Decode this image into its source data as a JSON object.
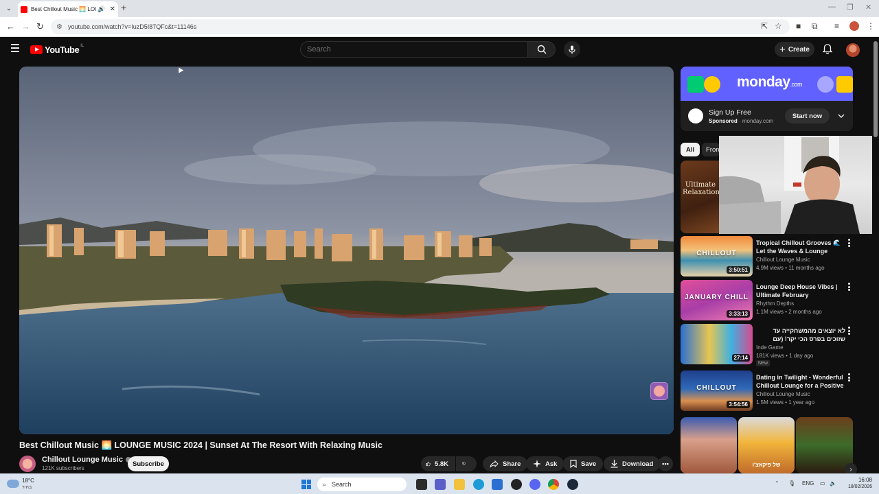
{
  "browser": {
    "tab_title": "Best Chillout Music 🌅 LOUNGE",
    "url": "youtube.com/watch?v=IuzD5I87QFc&t=11146s"
  },
  "header": {
    "logo_text": "YouTube",
    "logo_country": "IL",
    "search_placeholder": "Search",
    "create_label": "Create"
  },
  "video": {
    "title": "Best Chillout Music 🌅 LOUNGE MUSIC 2024 | Sunset At The Resort With Relaxing Music",
    "channel_name": "Chillout Lounge Music",
    "subscribers": "121K subscribers",
    "subscribe_label": "Subscribe",
    "likes": "5.8K",
    "share_label": "Share",
    "ask_label": "Ask",
    "save_label": "Save",
    "download_label": "Download"
  },
  "ad": {
    "brand": "monday",
    "brand_suffix": ".com",
    "title": "Sign Up Free",
    "sponsored": "Sponsored",
    "domain": "monday.com",
    "cta": "Start now"
  },
  "chips": [
    "All",
    "From"
  ],
  "first_thumb_text": "Ultimate Relaxation",
  "recommendations": [
    {
      "title": "Tropical Chillout Grooves 🌊 Let the Waves & Lounge Music...",
      "channel": "Chillout Lounge Music",
      "meta": "4.9M views • 11 months ago",
      "duration": "3:50:51",
      "thumb_label": "CHILLOUT",
      "badge": "",
      "rtl": false
    },
    {
      "title": "Lounge Deep House Vibes | Ultimate February Background...",
      "channel": "Rhythm Depths",
      "meta": "1.1M views • 2 months ago",
      "duration": "3:33:13",
      "thumb_label": "JANUARY CHILL",
      "badge": "",
      "rtl": false
    },
    {
      "title": "לא יוצאים מהמשחקייה עד שזוכים בפרס הכי יקר! (עם הבובים)",
      "channel": "Inde Game",
      "meta": "181K views • 1 day ago",
      "duration": "27:14",
      "thumb_label": "",
      "badge": "New",
      "rtl": true
    },
    {
      "title": "Dating in Twilight - Wonderful Chillout Lounge for a Positive ...",
      "channel": "Chillout Lounge Music",
      "meta": "1.5M views • 1 year ago",
      "duration": "3:54:56",
      "thumb_label": "CHILLOUT",
      "badge": "",
      "rtl": false
    }
  ],
  "shorts_caption": "של פיקאצ'ו",
  "taskbar": {
    "temp": "18°C",
    "weather": "בהיר",
    "search_label": "Search",
    "lang": "ENG",
    "time": "16:08",
    "date": "18/02/2026"
  }
}
